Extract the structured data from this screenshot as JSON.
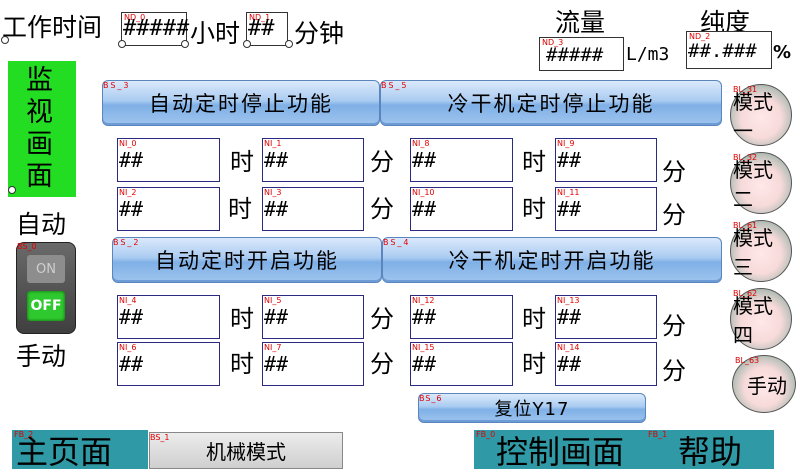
{
  "header": {
    "work_time_label": "工作时间",
    "hour_label": "小时",
    "minute_label": "分钟",
    "hours_tag": "ND_0",
    "hours_value": "#####",
    "minutes_tag": "ND_1",
    "minutes_value": "##",
    "flow_label": "流量",
    "flow_tag": "ND_3",
    "flow_value": "#####",
    "flow_unit": "L/m3",
    "purity_label": "纯度",
    "purity_tag": "ND_2",
    "purity_value": "##.###",
    "purity_unit": "%"
  },
  "monitor_panel": {
    "label": "监视画面"
  },
  "mode_switch": {
    "auto_label": "自动",
    "manual_label": "手动",
    "tag": "BS_0",
    "on_text": "ON",
    "off_text": "OFF"
  },
  "function_buttons": {
    "auto_stop": {
      "tag": "BS_3",
      "label": "自动定时停止功能"
    },
    "dryer_stop": {
      "tag": "BS_5",
      "label": "冷干机定时停止功能"
    },
    "auto_start": {
      "tag": "BS_2",
      "label": "自动定时开启功能"
    },
    "dryer_start": {
      "tag": "BS_4",
      "label": "冷干机定时开启功能"
    }
  },
  "time_units": {
    "hour": "时",
    "minute": "分"
  },
  "numeric_inputs": {
    "ni0": {
      "tag": "NI_0",
      "value": "##"
    },
    "ni1": {
      "tag": "NI_1",
      "value": "##"
    },
    "ni2": {
      "tag": "NI_2",
      "value": "##"
    },
    "ni3": {
      "tag": "NI_3",
      "value": "##"
    },
    "ni8": {
      "tag": "NI_8",
      "value": "##"
    },
    "ni9": {
      "tag": "NI_9",
      "value": "##"
    },
    "ni10": {
      "tag": "NI_10",
      "value": "##"
    },
    "ni11": {
      "tag": "NI_11",
      "value": "##"
    },
    "ni4": {
      "tag": "NI_4",
      "value": "##"
    },
    "ni5": {
      "tag": "NI_5",
      "value": "##"
    },
    "ni6": {
      "tag": "NI_6",
      "value": "##"
    },
    "ni7": {
      "tag": "NI_7",
      "value": "##"
    },
    "ni12": {
      "tag": "NI_12",
      "value": "##"
    },
    "ni13": {
      "tag": "NI_13",
      "value": "##"
    },
    "ni15": {
      "tag": "NI_15",
      "value": "##"
    },
    "ni14": {
      "tag": "NI_14",
      "value": "##"
    }
  },
  "mode_buttons": [
    {
      "tag": "BL_31",
      "label": "模式一"
    },
    {
      "tag": "BL_32",
      "label": "模式二"
    },
    {
      "tag": "BL_61",
      "label": "模式三"
    },
    {
      "tag": "BL_62",
      "label": "模式四"
    },
    {
      "tag": "BL_63",
      "label": "手动"
    }
  ],
  "reset_button": {
    "tag": "BS_6",
    "label": "复位Y17"
  },
  "bottom_nav": {
    "main_page": {
      "tag": "FB_2",
      "label": "主页面"
    },
    "mechanical_mode": {
      "tag": "BS_1",
      "label": "机械模式"
    },
    "control_page": {
      "tag": "FB_0",
      "label": "控制画面"
    },
    "help": {
      "tag": "FB_1",
      "label": "帮助"
    }
  },
  "colors": {
    "monitor_green": "#22dd22",
    "tag_red": "#e00000",
    "bottom_teal": "#2f9aa6",
    "blue_button": "#9fc4ee"
  }
}
